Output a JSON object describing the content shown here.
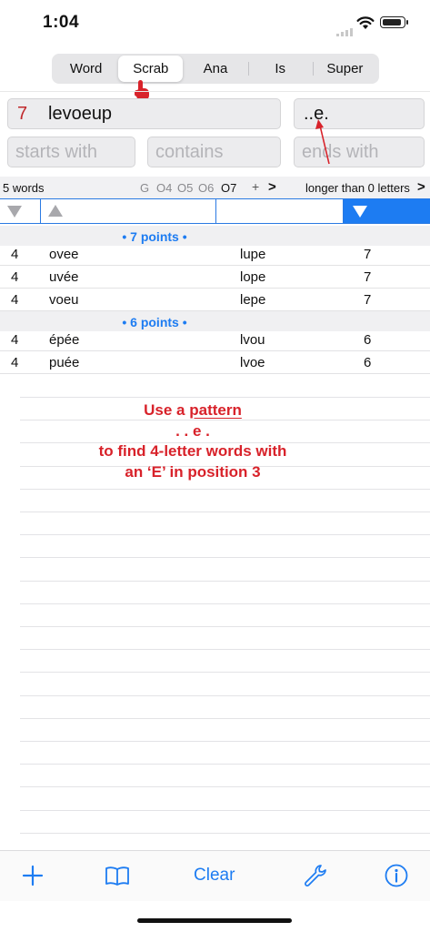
{
  "status_bar": {
    "time": "1:04"
  },
  "segments": [
    {
      "label": "Word",
      "active": false
    },
    {
      "label": "Scrab",
      "active": true
    },
    {
      "label": "Ana",
      "active": false
    },
    {
      "label": "Is",
      "active": false
    },
    {
      "label": "Super",
      "active": false
    }
  ],
  "input": {
    "count": "7",
    "letters": "levoeup",
    "pattern": "..e."
  },
  "filters": {
    "starts_placeholder": "starts with",
    "contains_placeholder": "contains",
    "ends_placeholder": "ends with"
  },
  "info_bar": {
    "count_label": "5 words",
    "g": "G",
    "o4": "O4",
    "o5": "O5",
    "o6": "O6",
    "o7": "O7",
    "plus": "+",
    "chevron": ">",
    "longer_label": "longer than 0 letters",
    "longer_chevron": ">"
  },
  "results": {
    "groups": [
      {
        "header": "• 7 points •",
        "rows": [
          {
            "len": "4",
            "word": "ovee",
            "sub": "lupe",
            "points": "7"
          },
          {
            "len": "4",
            "word": "uvée",
            "sub": "lope",
            "points": "7"
          },
          {
            "len": "4",
            "word": "voeu",
            "sub": "lepe",
            "points": "7"
          }
        ]
      },
      {
        "header": "• 6 points •",
        "rows": [
          {
            "len": "4",
            "word": "épée",
            "sub": "lvou",
            "points": "6"
          },
          {
            "len": "4",
            "word": "puée",
            "sub": "lvoe",
            "points": "6"
          }
        ]
      }
    ]
  },
  "annotation": {
    "line1_prefix": "Use a ",
    "line1_underlined": "pattern",
    "line2": ". . e .",
    "line3": "to find 4-letter words with",
    "line4": "an ‘E’ in position 3"
  },
  "toolbar": {
    "clear_label": "Clear"
  },
  "colors": {
    "accent": "#1d7cf2",
    "annotation": "#d8222a",
    "count": "#c0282b"
  }
}
